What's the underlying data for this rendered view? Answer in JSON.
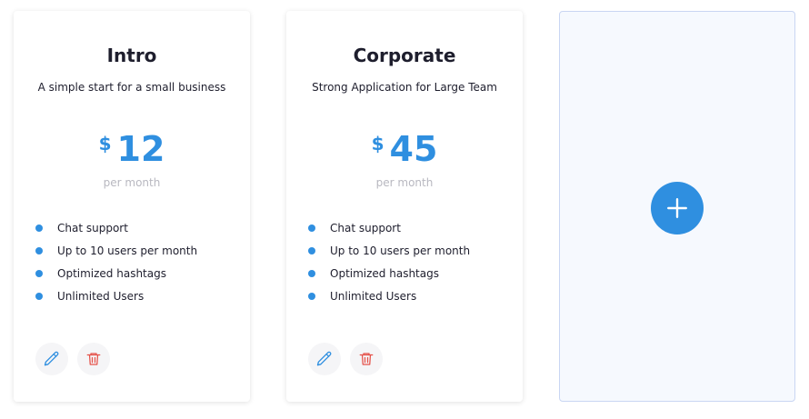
{
  "plans": [
    {
      "name": "Intro",
      "description": "A simple start for a small business",
      "currency": "$",
      "price": "12",
      "period": "per month",
      "features": [
        "Chat support",
        "Up to 10 users per month",
        "Optimized hashtags",
        "Unlimited Users"
      ]
    },
    {
      "name": "Corporate",
      "description": "Strong Application for Large Team",
      "currency": "$",
      "price": "45",
      "period": "per month",
      "features": [
        "Chat support",
        "Up to 10 users per month",
        "Optimized hashtags",
        "Unlimited Users"
      ]
    }
  ],
  "icons": {
    "edit": "pencil-icon",
    "delete": "trash-icon",
    "add": "plus-icon"
  },
  "colors": {
    "accent": "#2f8fe0",
    "delete": "#e5534b",
    "add_card_bg": "#f6f9fe",
    "add_card_border": "#c9d6f3"
  }
}
